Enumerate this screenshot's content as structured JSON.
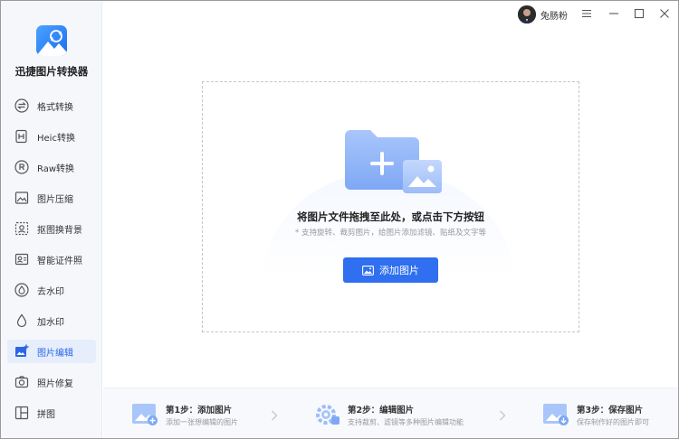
{
  "app": {
    "title": "迅捷图片转换器",
    "brand_color": "#2f6ff0"
  },
  "titlebar": {
    "username": "兔肠粉",
    "menu_icon": "hamburger-menu-icon",
    "minimize_icon": "minimize-icon",
    "maximize_icon": "maximize-icon",
    "close_icon": "close-icon"
  },
  "sidebar": {
    "items": [
      {
        "label": "格式转换",
        "icon": "format-convert-icon",
        "active": false
      },
      {
        "label": "Heic转换",
        "icon": "heic-icon",
        "active": false
      },
      {
        "label": "Raw转换",
        "icon": "raw-icon",
        "active": false
      },
      {
        "label": "图片压缩",
        "icon": "compress-icon",
        "active": false
      },
      {
        "label": "抠图换背景",
        "icon": "cutout-icon",
        "active": false
      },
      {
        "label": "智能证件照",
        "icon": "id-photo-icon",
        "active": false
      },
      {
        "label": "去水印",
        "icon": "remove-watermark-icon",
        "active": false
      },
      {
        "label": "加水印",
        "icon": "add-watermark-icon",
        "active": false
      },
      {
        "label": "图片编辑",
        "icon": "image-edit-icon",
        "active": true
      },
      {
        "label": "照片修复",
        "icon": "photo-repair-icon",
        "active": false
      },
      {
        "label": "拼图",
        "icon": "collage-icon",
        "active": false
      }
    ]
  },
  "dropzone": {
    "title": "将图片文件拖拽至此处，或点击下方按钮",
    "subtitle": "* 支持旋转、裁剪图片，给图片添加滤镜、贴纸及文字等",
    "button_label": "添加图片"
  },
  "steps": [
    {
      "title": "第1步：添加图片",
      "desc": "添加一张想编辑的图片"
    },
    {
      "title": "第2步：编辑图片",
      "desc": "支持裁剪、滤镜等多种图片编辑功能"
    },
    {
      "title": "第3步：保存图片",
      "desc": "保存制作好的图片即可"
    }
  ]
}
